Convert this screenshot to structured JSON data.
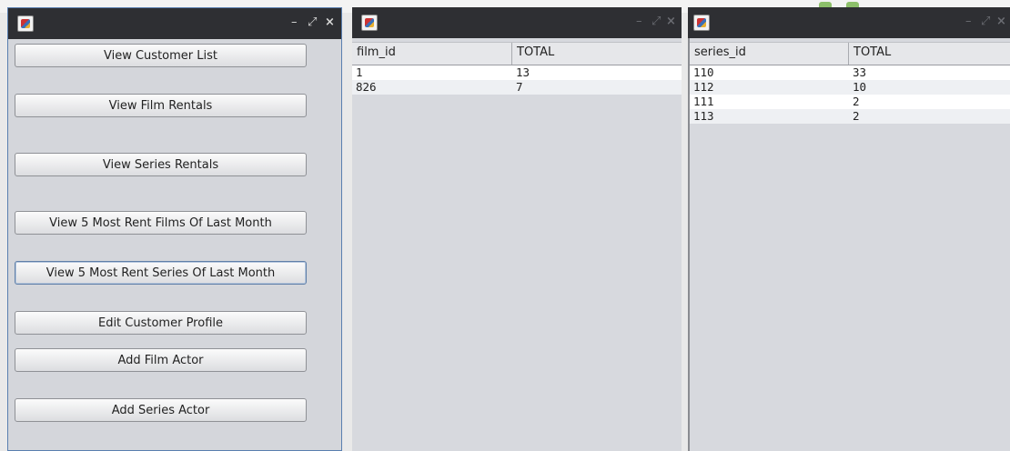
{
  "menu_window": {
    "controls": {
      "minimize": "–",
      "restore": "⤢",
      "close": "×"
    },
    "buttons": [
      {
        "label": "View Customer List"
      },
      {
        "label": "View Film Rentals"
      },
      {
        "label": "View Series Rentals"
      },
      {
        "label": "View 5 Most Rent Films Of Last Month"
      },
      {
        "label": "View 5 Most Rent Series Of Last Month"
      },
      {
        "label": "Edit Customer Profile"
      },
      {
        "label": "Add Film Actor"
      },
      {
        "label": "Add Series Actor"
      }
    ]
  },
  "film_window": {
    "controls": {
      "minimize": "–",
      "restore": "⤢",
      "close": "×"
    },
    "columns": [
      "film_id",
      "TOTAL"
    ],
    "rows": [
      [
        "1",
        "13"
      ],
      [
        "826",
        "7"
      ]
    ]
  },
  "series_window": {
    "controls": {
      "minimize": "–",
      "restore": "⤢",
      "close": "×"
    },
    "columns": [
      "series_id",
      "TOTAL"
    ],
    "rows": [
      [
        "110",
        "33"
      ],
      [
        "112",
        "10"
      ],
      [
        "111",
        "2"
      ],
      [
        "113",
        "2"
      ]
    ]
  },
  "colors": {
    "titlebar": "#2e2f33",
    "panel": "#d7d9de",
    "accent_border": "#5a7fb0"
  }
}
